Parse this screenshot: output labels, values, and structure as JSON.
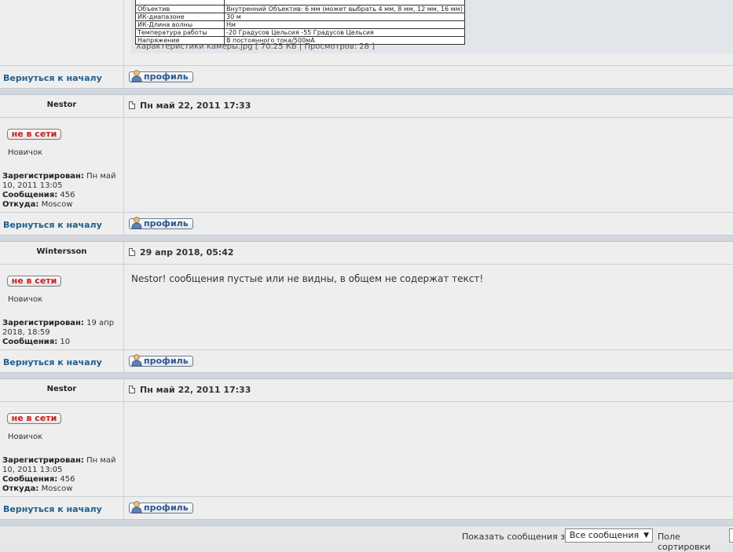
{
  "attachment": {
    "rows": [
      [
        "Объектив",
        "Внутренний Объектив: 6 мм (может выбрать 4 мм, 8 мм, 12 мм, 16 мм)"
      ],
      [
        "ИК-диапазоне",
        "30 м"
      ],
      [
        "ИК-Длина волны",
        "Нм"
      ],
      [
        "Температура работы",
        "-20 Градусов Цельсия -55 Градусов Цельсия"
      ],
      [
        "Напряжение",
        "В постоянного тока/500мА"
      ]
    ],
    "file_name": "Характеристики камеры.jpg",
    "file_info": "[ 70.25 КБ | Просмотров: 28 ]"
  },
  "common": {
    "back_to_top": "Вернуться к началу",
    "profile": "профиль",
    "offline": "не в сети",
    "registered_label": "Зарегистрирован:",
    "posts_label": "Сообщения:",
    "from_label": "Откуда:"
  },
  "posts": [
    {
      "author": "Nestor",
      "date": "Пн май 22, 2011 17:33",
      "rank": "Новичок",
      "registered": "Пн май 10, 2011 13:05",
      "posts": "456",
      "from": "Moscow",
      "text": ""
    },
    {
      "author": "Wintersson",
      "date": "29 апр 2018, 05:42",
      "rank": "Новичок",
      "registered": "19 апр 2018, 18:59",
      "posts": "10",
      "text": "Nestor! сообщения пустые или не видны, в общем не содержат текст!"
    },
    {
      "author": "Nestor",
      "date": "Пн май 22, 2011 17:33",
      "rank": "Новичок",
      "registered": "Пн май 10, 2011 13:05",
      "posts": "456",
      "from": "Moscow",
      "text": ""
    }
  ],
  "footer": {
    "show_label": "Показать сообщения за:",
    "select_value": "Все сообщения",
    "sort_label": "Поле сортировки"
  }
}
